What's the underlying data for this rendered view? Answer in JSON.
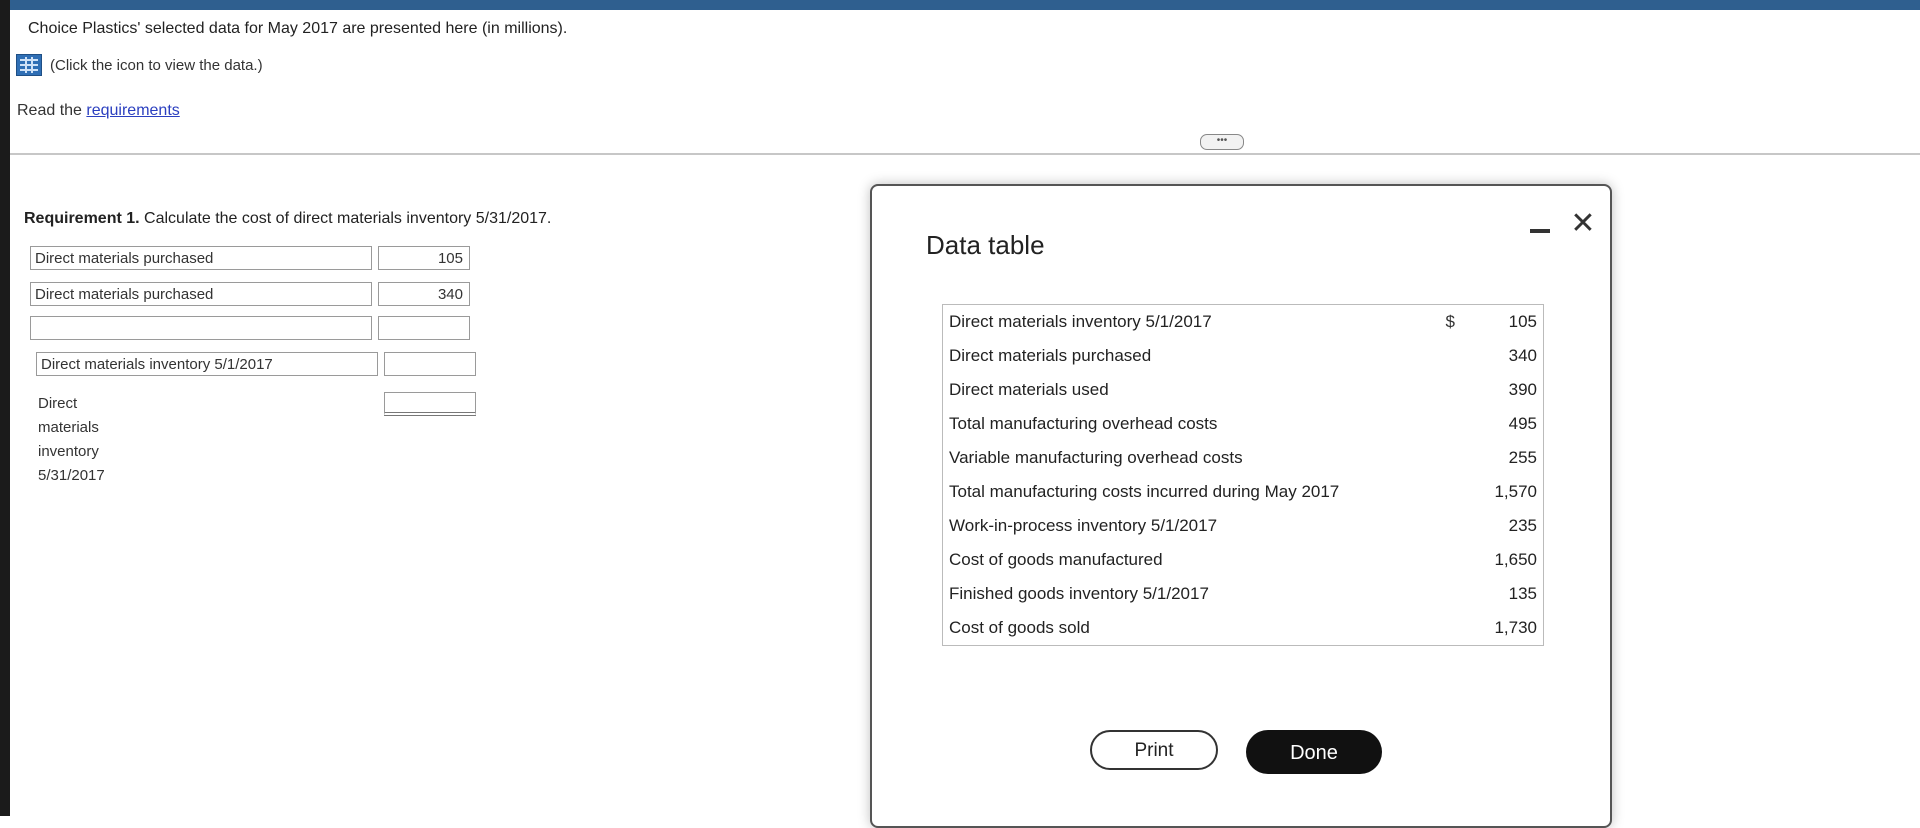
{
  "intro": {
    "text": "Choice Plastics' selected data for May 2017 are presented here (in millions).",
    "view_data_text": "(Click the icon to view the data.)"
  },
  "read": {
    "prefix": "Read the ",
    "link": "requirements"
  },
  "requirement1": {
    "bold": "Requirement 1.",
    "text": " Calculate the cost of direct materials inventory 5/31/2017.",
    "rows": [
      {
        "label": "Direct materials purchased",
        "value": "105"
      },
      {
        "label": "Direct materials purchased",
        "value": "340"
      },
      {
        "label": "",
        "value": ""
      },
      {
        "label": "Direct materials inventory 5/1/2017",
        "value": ""
      },
      {
        "label": "Direct materials inventory 5/31/2017",
        "value": ""
      }
    ]
  },
  "dialog": {
    "title": "Data table",
    "close_glyph": "✕",
    "currency": "$",
    "rows": [
      {
        "label": "Direct materials inventory 5/1/2017",
        "value": "105"
      },
      {
        "label": "Direct materials purchased",
        "value": "340"
      },
      {
        "label": "Direct materials used",
        "value": "390"
      },
      {
        "label": "Total manufacturing overhead costs",
        "value": "495"
      },
      {
        "label": "Variable manufacturing overhead costs",
        "value": "255"
      },
      {
        "label": "Total manufacturing costs incurred during May 2017",
        "value": "1,570"
      },
      {
        "label": "Work-in-process inventory 5/1/2017",
        "value": "235"
      },
      {
        "label": "Cost of goods manufactured",
        "value": "1,650"
      },
      {
        "label": "Finished goods inventory 5/1/2017",
        "value": "135"
      },
      {
        "label": "Cost of goods sold",
        "value": "1,730"
      }
    ],
    "print_label": "Print",
    "done_label": "Done"
  }
}
